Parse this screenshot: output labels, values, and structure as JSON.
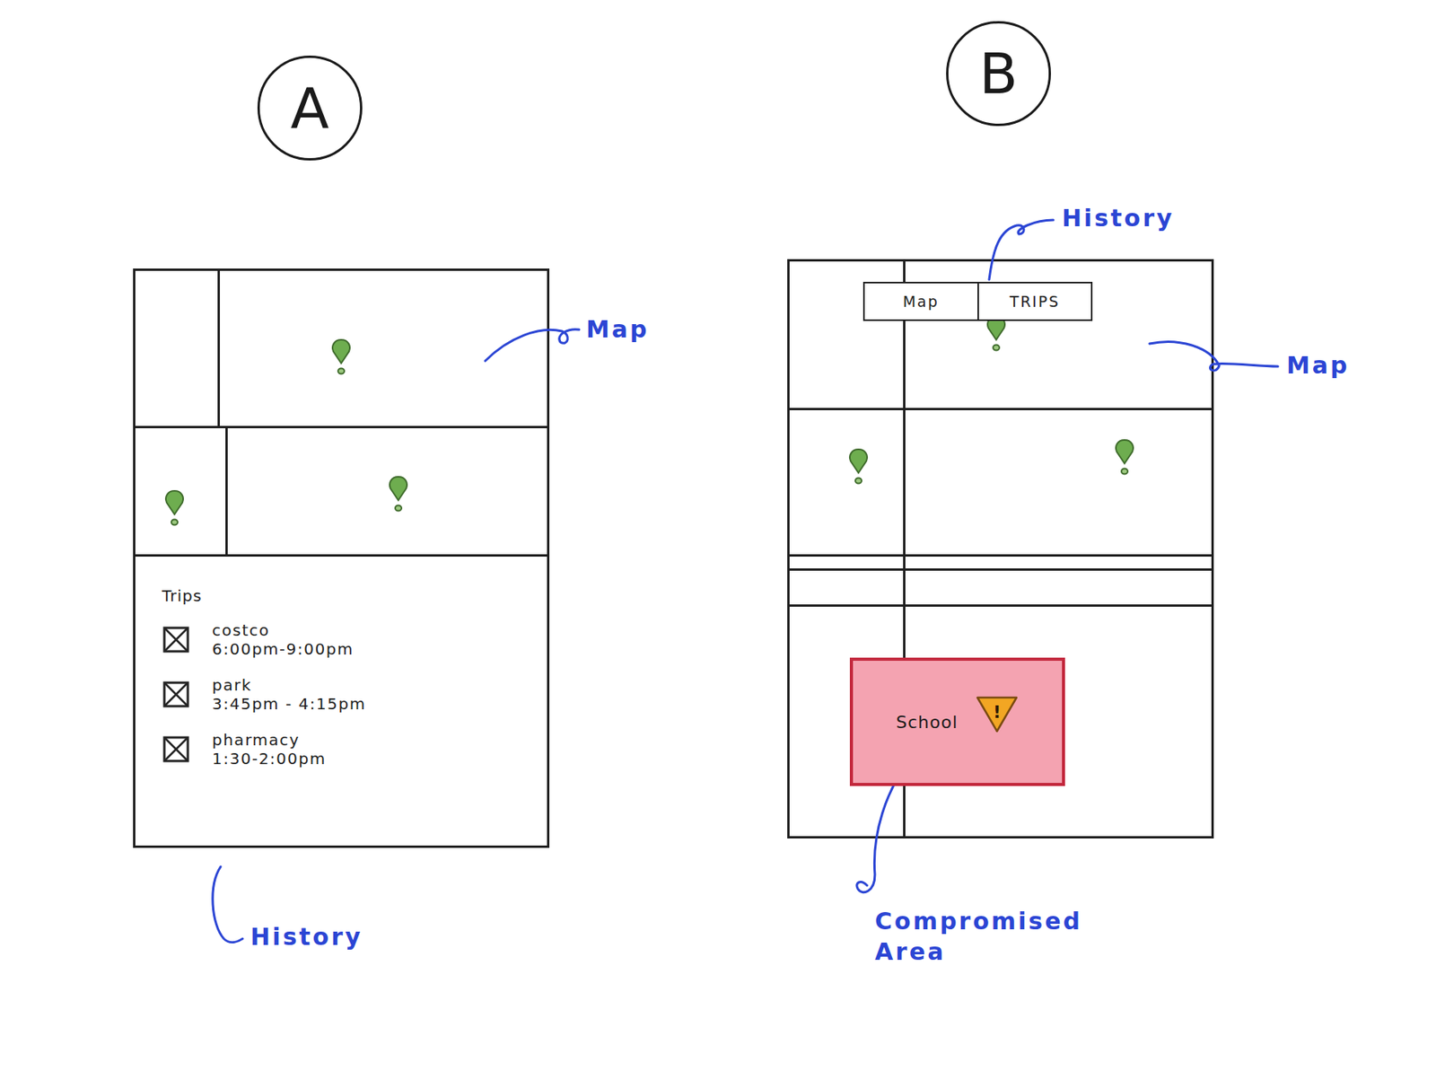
{
  "sketch_a": {
    "label": "A",
    "annotations": [
      {
        "text": "Map"
      },
      {
        "text": "History"
      }
    ],
    "history": {
      "title": "Trips",
      "trips": [
        {
          "place": "costco",
          "time": "6:00pm-9:00pm",
          "checked": true
        },
        {
          "place": "park",
          "time": "3:45pm - 4:15pm",
          "checked": true
        },
        {
          "place": "pharmacy",
          "time": "1:30-2:00pm",
          "checked": true
        }
      ]
    }
  },
  "sketch_b": {
    "label": "B",
    "annotations": [
      {
        "text": "History"
      },
      {
        "text": "Map"
      },
      {
        "text": "Compromised Area"
      }
    ],
    "tabs": [
      {
        "label": "Map",
        "selected": false
      },
      {
        "label": "TRIPS",
        "selected": false
      }
    ],
    "zone": {
      "label": "School",
      "warning": "!",
      "color": "#f4a3b1"
    }
  }
}
